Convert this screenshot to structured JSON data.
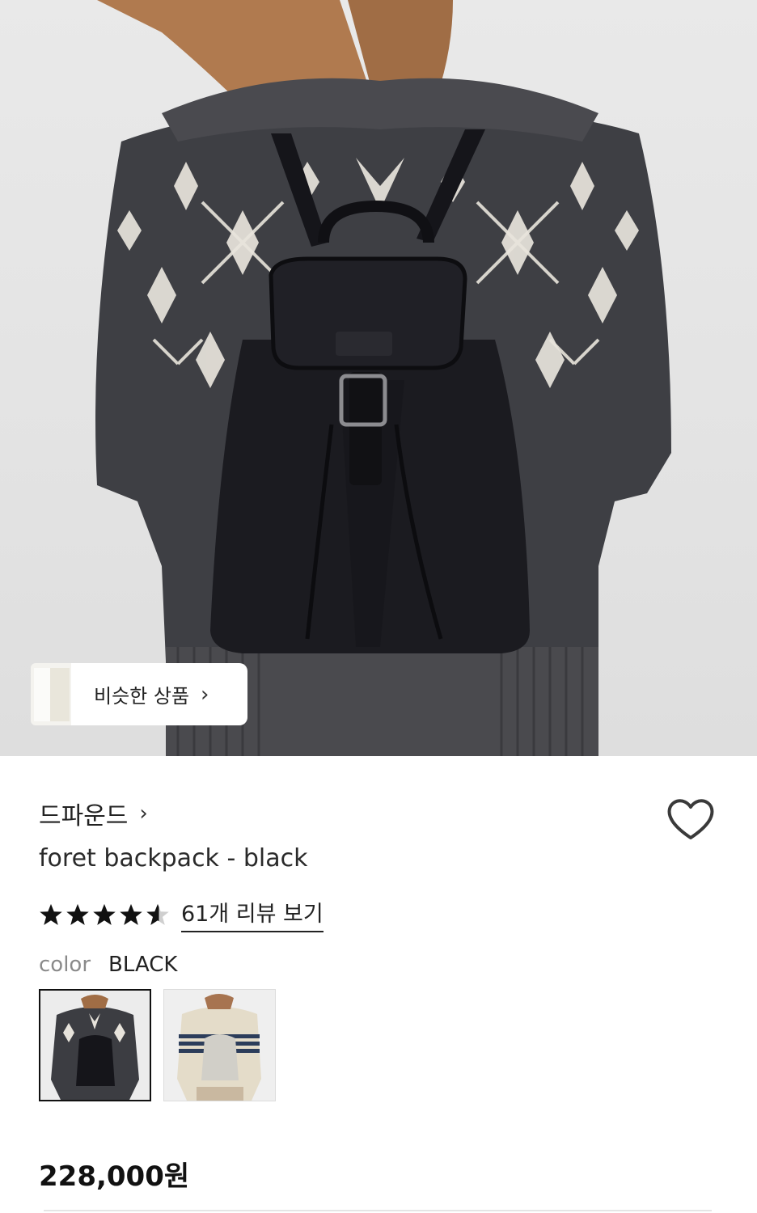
{
  "similar_products": {
    "label": "비슷한 상품",
    "chevron": "›",
    "icon": "chevron-right-icon"
  },
  "product": {
    "brand": "드파운드",
    "brand_chevron": "›",
    "title": "foret backpack - black",
    "rating": 4.5,
    "rating_max": 5,
    "review_link": "61개 리뷰 보기",
    "color_label": "color",
    "color_value": "BLACK",
    "price": "228,000원"
  },
  "swatches": [
    {
      "name": "black",
      "selected": true
    },
    {
      "name": "ivory",
      "selected": false
    }
  ],
  "colors": {
    "text": "#1a1a1a",
    "muted": "#8a8a8a",
    "border_selected": "#111111"
  },
  "icons": {
    "wishlist": "heart-outline-icon",
    "star": "star-icon"
  }
}
